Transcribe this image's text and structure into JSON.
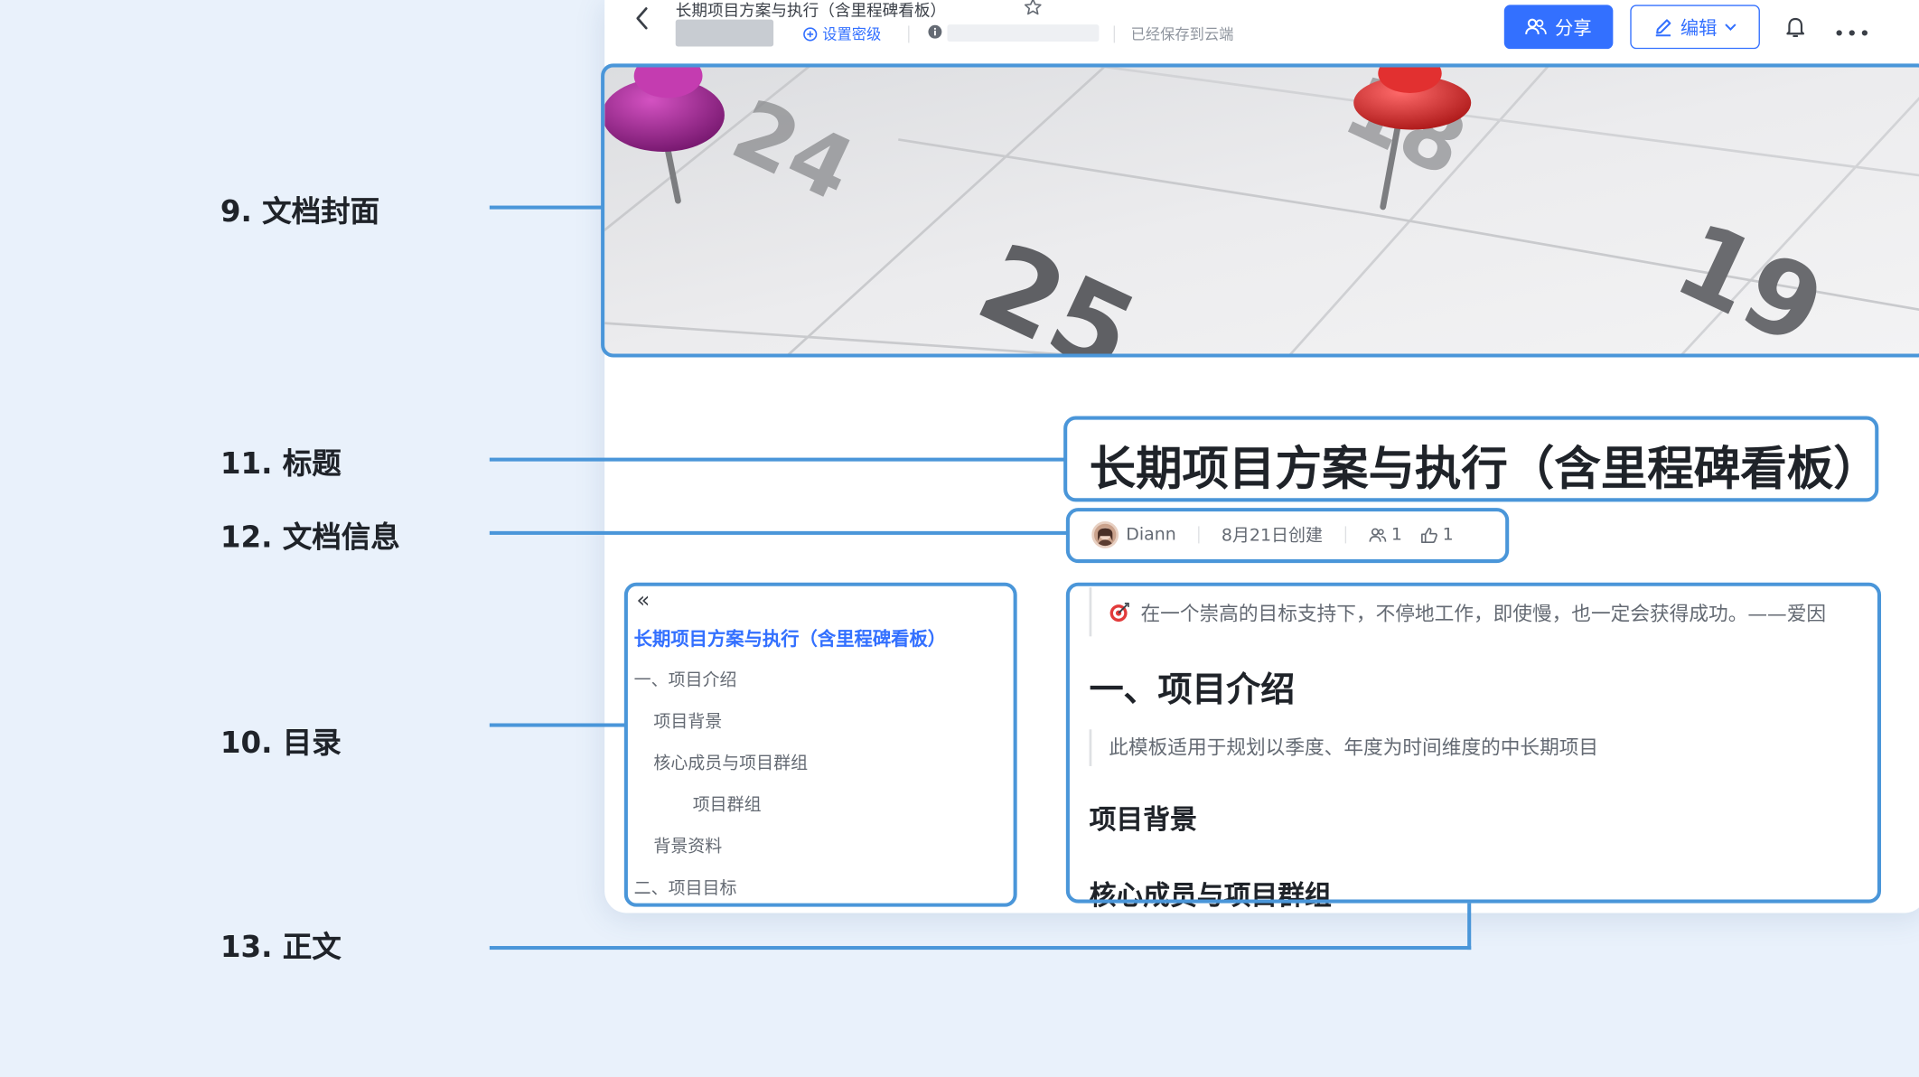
{
  "annotations": [
    {
      "label": "9. 文档封面"
    },
    {
      "label": "11. 标题"
    },
    {
      "label": "12. 文档信息"
    },
    {
      "label": "10. 目录"
    },
    {
      "label": "13. 正文"
    }
  ],
  "topbar": {
    "doc_title": "长期项目方案与执行（含里程碑看板）",
    "security_label": "设置密级",
    "saved_status": "已经保存到云端",
    "share_label": "分享",
    "edit_label": "编辑"
  },
  "document": {
    "title": "长期项目方案与执行（含里程碑看板）",
    "meta": {
      "author": "Diann",
      "created": "8月21日创建",
      "collaborators": "1",
      "likes": "1"
    }
  },
  "toc": {
    "items": [
      {
        "label": "长期项目方案与执行（含里程碑看板）",
        "level": 0
      },
      {
        "label": "一、项目介绍",
        "level": 1
      },
      {
        "label": "项目背景",
        "level": 2
      },
      {
        "label": "核心成员与项目群组",
        "level": 2
      },
      {
        "label": "项目群组",
        "level": 3
      },
      {
        "label": "背景资料",
        "level": 2
      },
      {
        "label": "二、项目目标",
        "level": 1
      }
    ]
  },
  "body": {
    "quote": "在一个崇高的目标支持下，不停地工作，即使慢，也一定会获得成功。——爱因",
    "heading1": "一、项目介绍",
    "intro": "此模板适用于规划以季度、年度为时间维度的中长期项目",
    "heading_bg": "项目背景",
    "heading_members": "核心成员与项目群组"
  },
  "colors": {
    "accent": "#3370ff",
    "annotation": "#4a96d9",
    "background": "#e9f1fb"
  }
}
